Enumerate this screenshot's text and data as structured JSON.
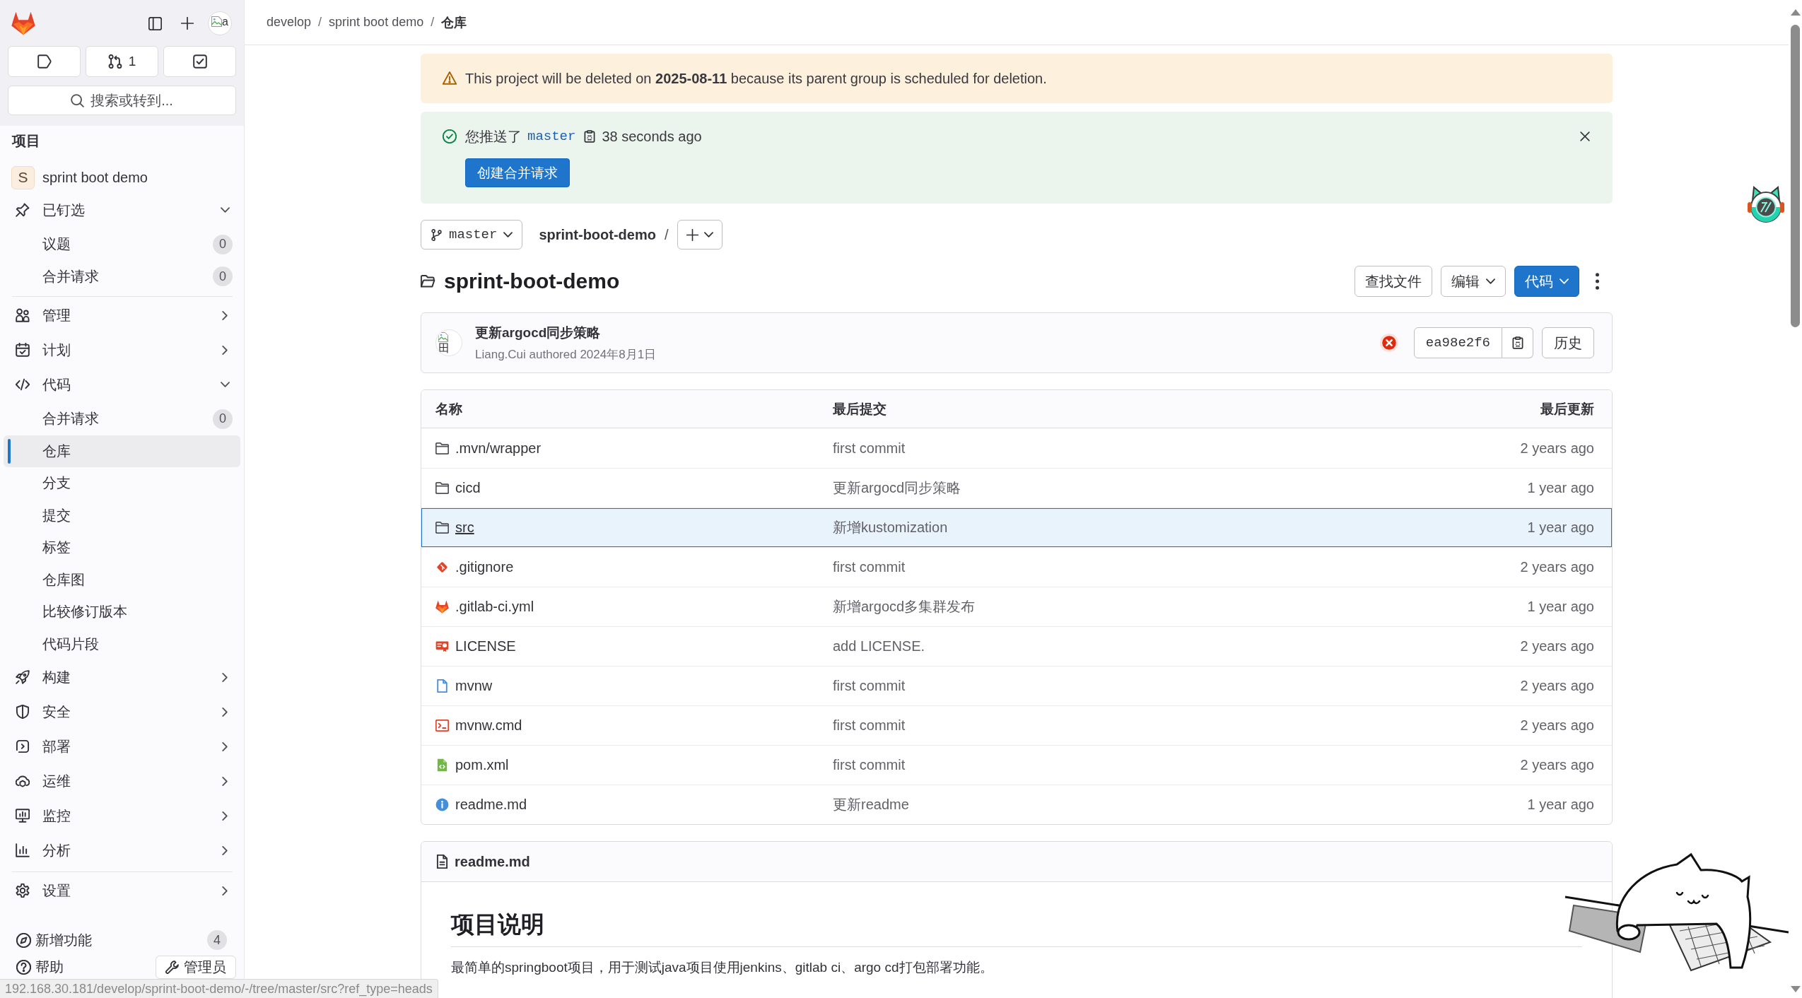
{
  "sidebar": {
    "user_avatar_alt": "a",
    "top_buttons": [
      {
        "kind": "issues"
      },
      {
        "kind": "merge_requests",
        "count": "1"
      },
      {
        "kind": "todos"
      }
    ],
    "search_button": "搜索或转到...",
    "section_title": "项目",
    "project": {
      "initial": "S",
      "name": "sprint boot demo"
    },
    "nav_sections": [
      {
        "items": [
          {
            "label": "已钉选",
            "expanded": true,
            "children": [
              {
                "label": "议题",
                "count": "0",
                "selected": false
              },
              {
                "label": "合并请求",
                "count": "0",
                "selected": false
              }
            ]
          }
        ]
      },
      {
        "items": [
          {
            "label": "管理",
            "expanded": false
          },
          {
            "label": "计划",
            "expanded": false
          },
          {
            "label": "代码",
            "expanded": true,
            "children": [
              {
                "label": "合并请求",
                "count": "0",
                "selected": false
              },
              {
                "label": "仓库",
                "selected": true
              },
              {
                "label": "分支",
                "selected": false
              },
              {
                "label": "提交",
                "selected": false
              },
              {
                "label": "标签",
                "selected": false
              },
              {
                "label": "仓库图",
                "selected": false
              },
              {
                "label": "比较修订版本",
                "selected": false
              },
              {
                "label": "代码片段",
                "selected": false
              }
            ]
          },
          {
            "label": "构建",
            "expanded": false
          },
          {
            "label": "安全",
            "expanded": false
          },
          {
            "label": "部署",
            "expanded": false
          },
          {
            "label": "运维",
            "expanded": false
          },
          {
            "label": "监控",
            "expanded": false
          },
          {
            "label": "分析",
            "expanded": false
          }
        ]
      },
      {
        "items": [
          {
            "label": "设置",
            "expanded": false
          }
        ]
      }
    ],
    "whats_new": {
      "label": "新增功能",
      "count": "4"
    },
    "help": "帮助",
    "admin_button": "管理员"
  },
  "breadcrumb": {
    "separator": "/",
    "items": [
      "develop",
      "sprint boot demo",
      "仓库"
    ]
  },
  "deletion_alert": {
    "text": "This project will be deleted on **2025-08-11** because its parent group is scheduled for deletion."
  },
  "push_alert": {
    "prefix": "您推送了",
    "branch": "master",
    "time": "38 seconds ago",
    "button": "创建合并请求"
  },
  "ref_bar": {
    "branch": "master",
    "path": "sprint-boot-demo",
    "separator": "/"
  },
  "project_title": "sprint-boot-demo",
  "title_actions": [
    {
      "label": "查找文件",
      "kind": "plain"
    },
    {
      "label": "编辑",
      "kind": "dropdown"
    },
    {
      "label": "代码",
      "kind": "primary"
    }
  ],
  "last_commit": {
    "avatar_alt": "田",
    "title": "更新argocd同步策略",
    "byline": "Liang.Cui authored 2024年8月1日",
    "pipeline_failed": true,
    "sha": "ea98e2f6",
    "history_button": "历史"
  },
  "file_table": {
    "columns": [
      "名称",
      "最后提交",
      "最后更新"
    ],
    "rows": [
      {
        "kind": "folder",
        "name": ".mvn/wrapper",
        "commit": "first commit",
        "updated": "2 years ago",
        "selected": false
      },
      {
        "kind": "folder",
        "name": "cicd",
        "commit": "更新argocd同步策略",
        "updated": "1 year ago",
        "selected": false
      },
      {
        "kind": "folder",
        "name": "src",
        "commit": "新增kustomization",
        "updated": "1 year ago",
        "selected": true
      },
      {
        "kind": "gitignore",
        "name": ".gitignore",
        "commit": "first commit",
        "updated": "2 years ago",
        "selected": false
      },
      {
        "kind": "ci_config",
        "name": ".gitlab-ci.yml",
        "commit": "新增argocd多集群发布",
        "updated": "1 year ago",
        "selected": false
      },
      {
        "kind": "license",
        "name": "LICENSE",
        "commit": "add LICENSE.",
        "updated": "2 years ago",
        "selected": false
      },
      {
        "kind": "file",
        "name": "mvnw",
        "commit": "first commit",
        "updated": "2 years ago",
        "selected": false
      },
      {
        "kind": "script",
        "name": "mvnw.cmd",
        "commit": "first commit",
        "updated": "2 years ago",
        "selected": false
      },
      {
        "kind": "xml",
        "name": "pom.xml",
        "commit": "first commit",
        "updated": "2 years ago",
        "selected": false
      },
      {
        "kind": "readme",
        "name": "readme.md",
        "commit": "更新readme",
        "updated": "1 year ago",
        "selected": false
      }
    ]
  },
  "readme": {
    "filename": "readme.md",
    "heading": "项目说明",
    "paragraph": "最简单的springboot项目，用于测试java项目使用jenkins、gitlab ci、argo cd打包部署功能。"
  },
  "status_url": "192.168.30.181/develop/sprint-boot-demo/-/tree/master/src?ref_type=heads"
}
